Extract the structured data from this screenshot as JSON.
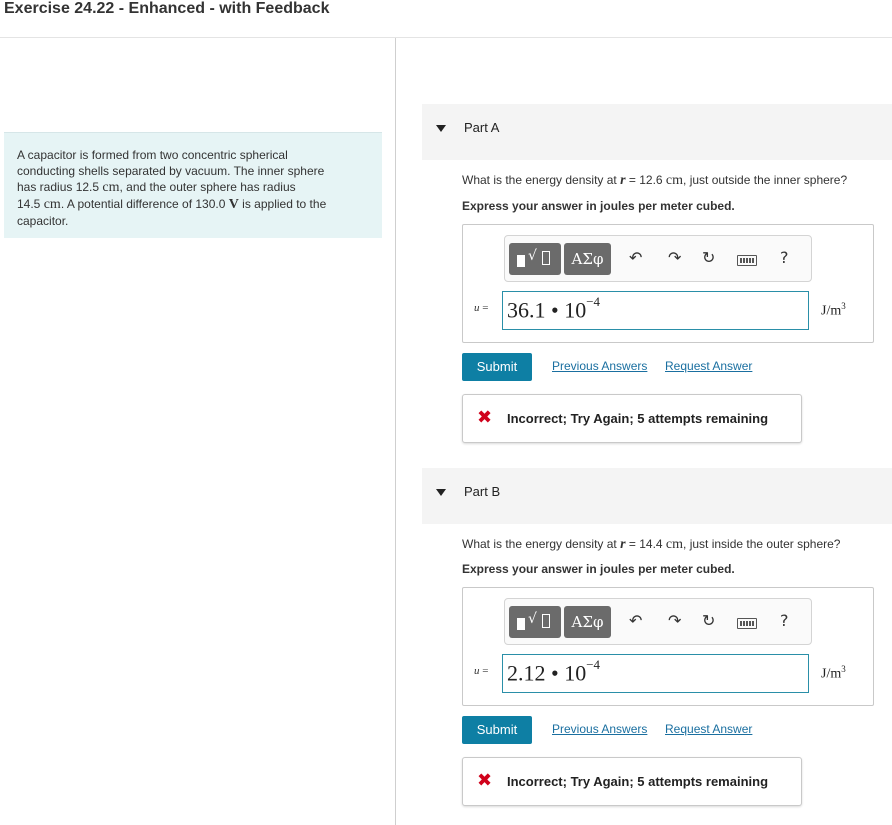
{
  "title": "Exercise 24.22 - Enhanced - with Feedback",
  "problem": {
    "line1": "A capacitor is formed from two concentric spherical",
    "line2": "conducting shells separated by vacuum. The inner sphere",
    "line3_a": "has radius 12.5 ",
    "line3_unit": "cm",
    "line3_b": ", and the outer sphere has radius",
    "line4_a": "14.5 ",
    "line4_unit": "cm",
    "line4_b": ". A potential difference of 130.0 ",
    "line4_v": "V",
    "line4_c": " is applied to the",
    "line5": "capacitor."
  },
  "toolbar": {
    "greek": "ΑΣφ",
    "undo": "↶",
    "redo": "↷",
    "reset": "↻",
    "help": "?"
  },
  "parts": [
    {
      "label": "Part A",
      "question_a": "What is the energy density at ",
      "question_var": "r",
      "question_b": " = 12.6 ",
      "question_unit": "cm",
      "question_c": ", just outside the inner sphere?",
      "express": "Express your answer in joules per meter cubed.",
      "var": "u",
      "var_eq": " =",
      "answer_mantissa": "36.1 • 10",
      "answer_exp": "−4",
      "unit": "J/m",
      "unit_exp": "3",
      "submit": "Submit",
      "prev": "Previous Answers",
      "request": "Request Answer",
      "feedback_icon": "✖",
      "feedback": "Incorrect; Try Again; 5 attempts remaining"
    },
    {
      "label": "Part B",
      "question_a": "What is the energy density at ",
      "question_var": "r",
      "question_b": " = 14.4 ",
      "question_unit": "cm",
      "question_c": ", just inside the outer sphere?",
      "express": "Express your answer in joules per meter cubed.",
      "var": "u",
      "var_eq": " =",
      "answer_mantissa": "2.12 • 10",
      "answer_exp": "−4",
      "unit": "J/m",
      "unit_exp": "3",
      "submit": "Submit",
      "prev": "Previous Answers",
      "request": "Request Answer",
      "feedback_icon": "✖",
      "feedback": "Incorrect; Try Again; 5 attempts remaining"
    }
  ]
}
